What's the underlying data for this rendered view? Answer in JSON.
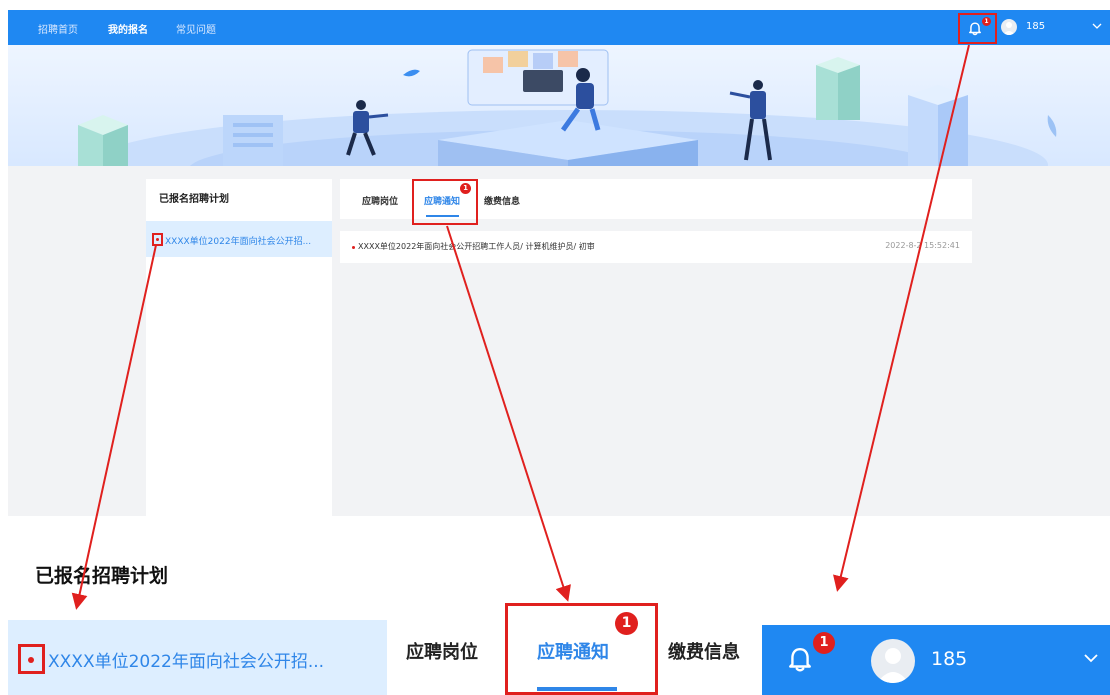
{
  "nav": {
    "links": [
      "招聘首页",
      "我的报名",
      "常见问题"
    ],
    "active_index": 1,
    "bell_badge": "1",
    "username": "185"
  },
  "left_panel": {
    "title": "已报名招聘计划",
    "item_label": "XXXX单位2022年面向社会公开招..."
  },
  "tabs": {
    "items": [
      "应聘岗位",
      "应聘通知",
      "缴费信息"
    ],
    "active_index": 1,
    "badge": "1"
  },
  "notice": {
    "text": "XXXX单位2022年面向社会公开招聘工作人员/ 计算机维护员/ 初审",
    "date": "2022-8-2 15:52:41"
  },
  "zoom": {
    "left_title": "已报名招聘计划",
    "left_item": "XXXX单位2022年面向社会公开招...",
    "tabs": [
      "应聘岗位",
      "应聘通知",
      "缴费信息"
    ],
    "tab_badge": "1",
    "bell_badge": "1",
    "username": "185"
  },
  "colors": {
    "primary": "#1f88f2",
    "accent_text": "#2f86e8",
    "highlight_red": "#e0201e",
    "selected_bg": "#ddeeff",
    "content_bg": "#f2f3f5"
  },
  "icons": {
    "bell": "bell-icon",
    "avatar": "user-avatar",
    "dropdown": "chevron-down-icon"
  }
}
